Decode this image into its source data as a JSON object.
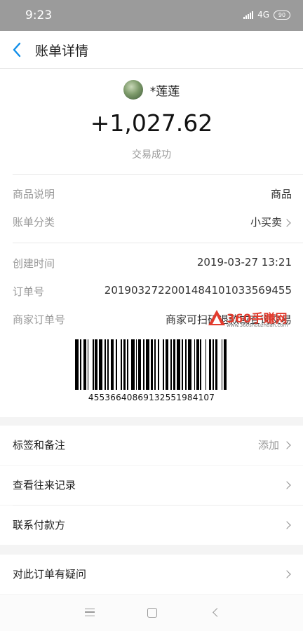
{
  "status_bar": {
    "time": "9:23",
    "network": "4G",
    "battery": "90"
  },
  "header": {
    "title": "账单详情",
    "back_icon": "chevron-left-icon"
  },
  "summary": {
    "name": "*莲莲",
    "amount": "+1,027.62",
    "status": "交易成功"
  },
  "details": {
    "product_desc": {
      "label": "商品说明",
      "value": "商品"
    },
    "category": {
      "label": "账单分类",
      "value": "小买卖"
    },
    "created": {
      "label": "创建时间",
      "value": "2019-03-27 13:21"
    },
    "order_no": {
      "label": "订单号",
      "value": "2019032722001484101033569455"
    },
    "merchant_order": {
      "label": "商家订单号",
      "value": "商家可扫码退款或查询交易"
    }
  },
  "watermark": {
    "text": "360手赚网",
    "sub": "www.360shouzhuan.com"
  },
  "barcode": {
    "number": "4553664086913255198410​7"
  },
  "actions": [
    {
      "label": "标签和备注",
      "extra": "添加"
    },
    {
      "label": "查看往来记录",
      "extra": ""
    },
    {
      "label": "联系付款方",
      "extra": ""
    },
    {
      "label": "对此订单有疑问",
      "extra": ""
    }
  ],
  "colors": {
    "accent": "#108ee9",
    "watermark": "#e23b2e",
    "status_bar": "#9b9b9b"
  }
}
